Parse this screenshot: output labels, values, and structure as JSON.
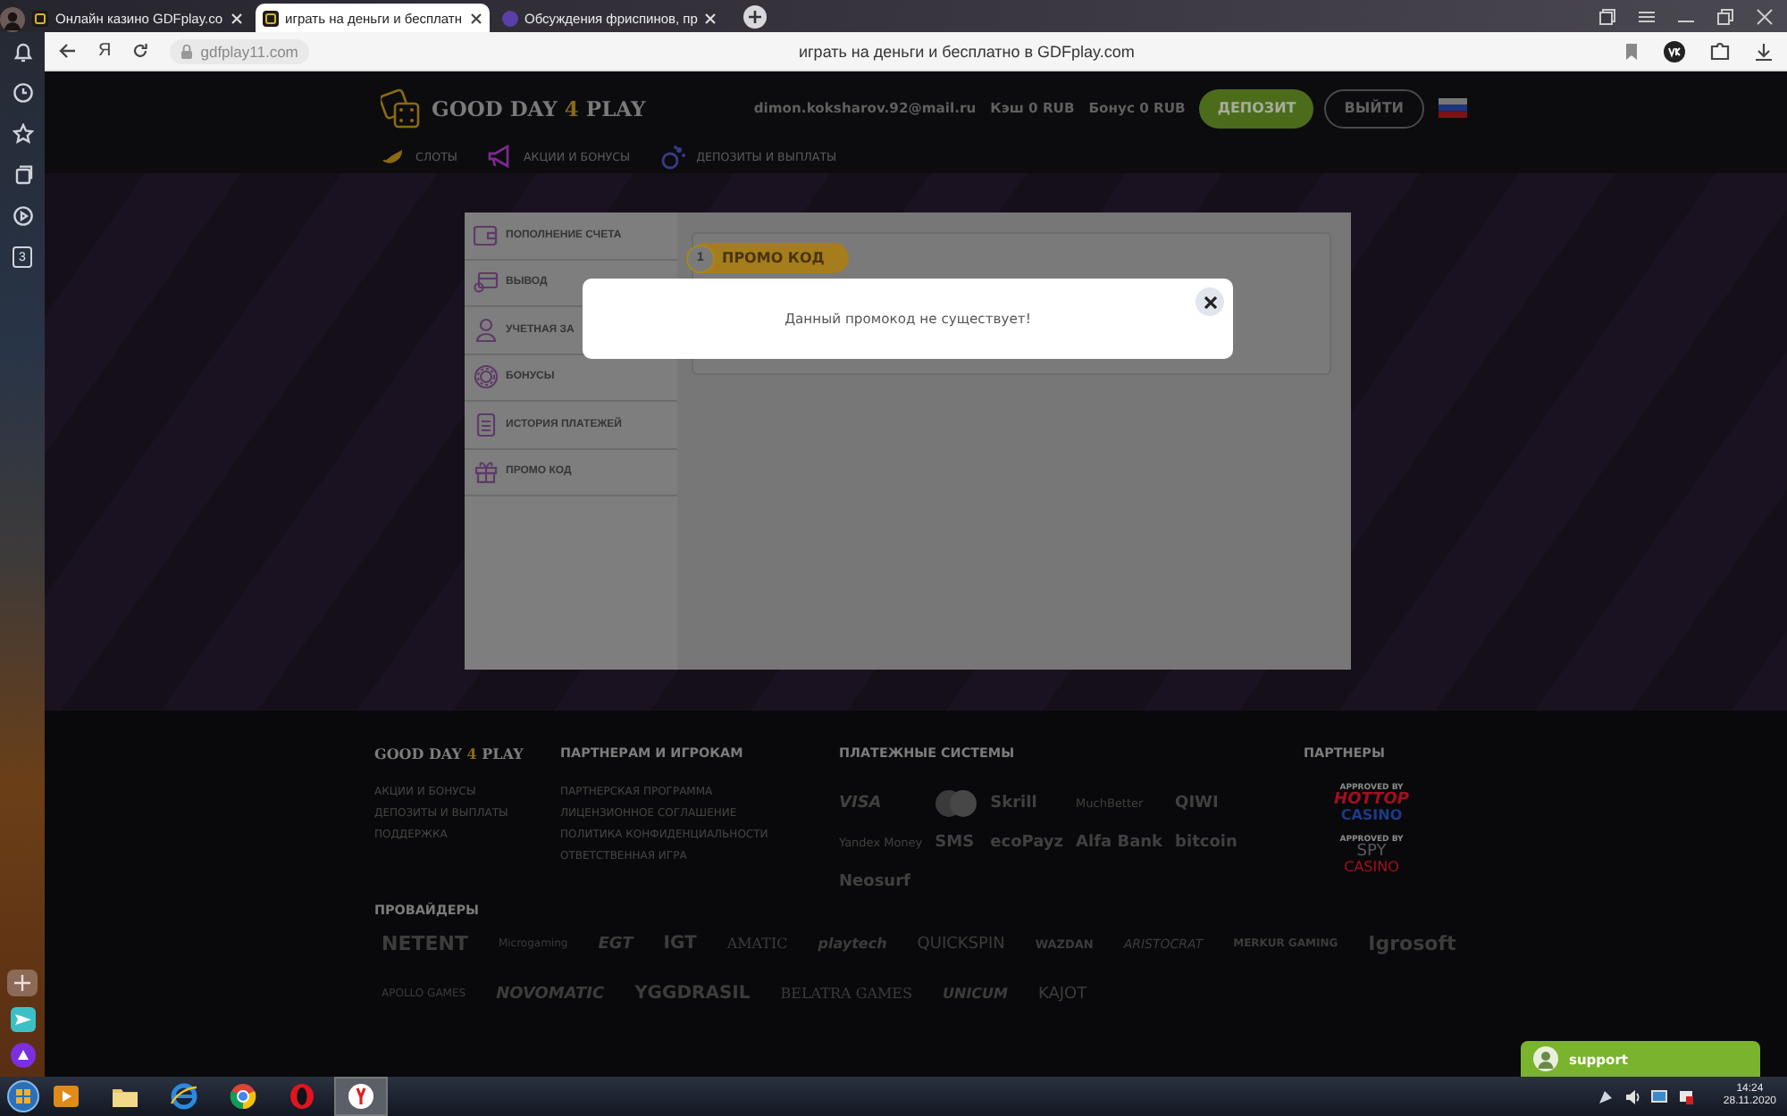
{
  "browser": {
    "tabs": [
      {
        "title": "Онлайн казино GDFplay.co",
        "selected": false
      },
      {
        "title": "играть на деньги и бесплатн",
        "selected": true
      },
      {
        "title": "Обсуждения фриспинов, пр",
        "selected": false
      }
    ],
    "address_bar": {
      "yandex_button": "Я",
      "url": "gdfplay11.com",
      "page_title": "играть на деньги и бесплатно в GDFplay.com"
    },
    "sidebar": {
      "tab_count": "3"
    }
  },
  "header": {
    "logo": {
      "before": "GOOD DAY",
      "number": "4",
      "after": "PLAY"
    },
    "email": "dimon.koksharov.92@mail.ru",
    "cash": "Кэш 0 RUB",
    "bonus": "Бонус 0 RUB",
    "buttons": [
      {
        "label": "ДЕПОЗИТ",
        "kind": "filled"
      },
      {
        "label": "ВЫЙТИ",
        "kind": "outline"
      }
    ],
    "nav": [
      {
        "label": "СЛОТЫ"
      },
      {
        "label": "АКЦИИ И БОНУСЫ"
      },
      {
        "label": "ДЕПОЗИТЫ И ВЫПЛАТЫ"
      }
    ]
  },
  "cabinet": {
    "menu": [
      {
        "label": "ПОПОЛНЕНИЕ СЧЕТА"
      },
      {
        "label": "ВЫВОД"
      },
      {
        "label": "УЧЕТНАЯ ЗА"
      },
      {
        "label": "БОНУСЫ"
      },
      {
        "label": "ИСТОРИЯ ПЛАТЕЖЕЙ"
      },
      {
        "label": "ПРОМО КОД"
      }
    ],
    "step": {
      "number": "1",
      "label": "ПРОМО КОД"
    }
  },
  "modal": {
    "message": "Данный промокод не существует!"
  },
  "footer": {
    "logo": {
      "before": "GOOD DAY",
      "number": "4",
      "after": "PLAY"
    },
    "site_links": [
      "АКЦИИ И БОНУСЫ",
      "ДЕПОЗИТЫ И ВЫПЛАТЫ",
      "ПОДДЕРЖКА"
    ],
    "partner_column": {
      "heading": "ПАРТНЕРАМ И ИГРОКАМ",
      "links": [
        "ПАРТНЕРСКАЯ ПРОГРАММА",
        "ЛИЦЕНЗИОННОЕ СОГЛАШЕНИЕ",
        "ПОЛИТИКА КОНФИДЕНЦИАЛЬНОСТИ",
        "ОТВЕТСТВЕННАЯ ИГРА"
      ]
    },
    "payment": {
      "heading": "ПЛАТЕЖНЫЕ СИСТЕМЫ",
      "logos": [
        {
          "kind": "text",
          "label": "VISA"
        },
        {
          "kind": "icon"
        },
        {
          "kind": "text",
          "label": "Skrill"
        },
        {
          "kind": "text",
          "label": "MuchBetter"
        },
        {
          "kind": "text",
          "label": "QIWI"
        },
        {
          "kind": "text",
          "label": "Yandex Money"
        },
        {
          "kind": "text",
          "label": "SMS"
        },
        {
          "kind": "text",
          "label": "ecoPayz"
        },
        {
          "kind": "text",
          "label": "Alfa Bank"
        },
        {
          "kind": "text",
          "label": "bitcoin"
        },
        {
          "kind": "text",
          "label": "Neosurf"
        }
      ]
    },
    "partners": {
      "heading": "ПАРТНЕРЫ",
      "logos": [
        {
          "note": "APPROVED BY",
          "name": "HOTTOP",
          "suffix": "CASINO"
        },
        {
          "note": "APPROVED BY",
          "name": "SPY",
          "suffix": "CASINO"
        }
      ]
    },
    "providers": {
      "heading": "ПРОВАЙДЕРЫ",
      "logos": [
        "NETENT",
        "Microgaming",
        "EGT",
        "IGT",
        "AMATIC",
        "playtech",
        "QUICKSPIN",
        "WAZDAN",
        "ARISTOCRAT",
        "MERKUR GAMING",
        "Igrosoft",
        "APOLLO GAMES",
        "NOVOMATIC",
        "YGGDRASIL",
        "BELATRA GAMES",
        "UNICUM",
        "KAJOT"
      ]
    }
  },
  "support": {
    "label": "support"
  },
  "taskbar": {
    "time": "14:24",
    "date": "28.11.2020"
  }
}
